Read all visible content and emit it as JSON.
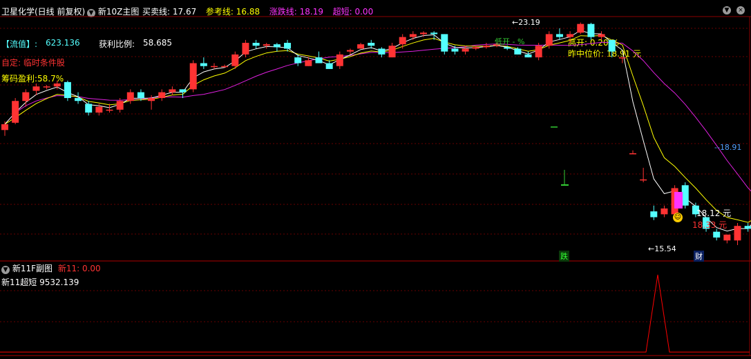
{
  "main_header": {
    "stock": "卫星化学(日线 前复权)",
    "indicator": "新10Z主图",
    "items": [
      {
        "label": "买卖线: 17.67",
        "color": "#ffffff"
      },
      {
        "label": "参考线: 16.88",
        "color": "#ffff00"
      },
      {
        "label": "涨跌线: 18.19",
        "color": "#ff33ff"
      },
      {
        "label": "超短: 0.00",
        "color": "#ff33ff"
      }
    ]
  },
  "info": {
    "float_label": "【流值】:",
    "float_value": "623.136",
    "profit_label": "获利比例:",
    "profit_value": "58.685",
    "custom": "自定: 临时条件股",
    "chip_profit": "筹码盈利:58.7%",
    "gap_open": "高开:  0.20 %",
    "prev_mid": "昨中位价:  18.91 元"
  },
  "annotations": {
    "high_label": "←23.19",
    "low_label": "←15.54",
    "last_label": "--18.91",
    "low_open_label": "低开 - %",
    "cost1": "18.12 元",
    "cost2": "18.33 元",
    "drop_tag": "跌",
    "money_tag": "财"
  },
  "sub_header": {
    "title": "新11F副图",
    "value": "新11: 0.00",
    "line2": "新11超短  9532.139"
  },
  "colors": {
    "up": "#ff3333",
    "down": "#54ffff",
    "white_line": "#ffffff",
    "yellow_line": "#ffff00",
    "magenta_line": "#e020e0",
    "spike": "#ff0000"
  },
  "chart_data": [
    {
      "type": "candlestick",
      "title": "卫星化学(日线 前复权)",
      "ohlc": [
        [
          19.5,
          19.8,
          19.3,
          19.7
        ],
        [
          19.75,
          20.6,
          19.7,
          20.5
        ],
        [
          20.5,
          20.9,
          20.3,
          20.8
        ],
        [
          20.85,
          21.1,
          20.7,
          21.0
        ],
        [
          21.0,
          21.05,
          20.9,
          21.0
        ],
        [
          21.0,
          21.2,
          20.9,
          21.1
        ],
        [
          21.15,
          21.2,
          20.5,
          20.6
        ],
        [
          20.6,
          20.8,
          20.4,
          20.5
        ],
        [
          20.4,
          20.5,
          20.0,
          20.1
        ],
        [
          20.1,
          20.4,
          20.0,
          20.3
        ],
        [
          20.2,
          20.4,
          20.1,
          20.2
        ],
        [
          20.2,
          20.6,
          20.1,
          20.5
        ],
        [
          20.5,
          20.9,
          20.4,
          20.8
        ],
        [
          20.8,
          20.9,
          20.5,
          20.6
        ],
        [
          20.5,
          20.7,
          20.2,
          20.6
        ],
        [
          20.6,
          20.9,
          20.5,
          20.8
        ],
        [
          20.8,
          21.0,
          20.7,
          20.9
        ],
        [
          20.9,
          20.9,
          20.6,
          20.8
        ],
        [
          20.9,
          21.9,
          20.8,
          21.8
        ],
        [
          21.8,
          22.0,
          21.6,
          21.7
        ],
        [
          21.7,
          21.8,
          21.6,
          21.7
        ],
        [
          21.7,
          21.75,
          21.65,
          21.7
        ],
        [
          21.7,
          22.2,
          21.6,
          22.1
        ],
        [
          22.1,
          22.6,
          22.0,
          22.5
        ],
        [
          22.5,
          22.6,
          22.3,
          22.4
        ],
        [
          22.4,
          22.5,
          22.3,
          22.45
        ],
        [
          22.45,
          22.5,
          22.2,
          22.35
        ],
        [
          22.5,
          22.6,
          22.2,
          22.3
        ],
        [
          22.0,
          22.1,
          21.7,
          21.8
        ],
        [
          21.7,
          22.0,
          21.7,
          21.9
        ],
        [
          22.0,
          22.2,
          21.8,
          21.8
        ],
        [
          21.8,
          21.9,
          21.6,
          21.6
        ],
        [
          21.7,
          22.2,
          21.6,
          22.1
        ],
        [
          22.2,
          22.3,
          22.1,
          22.25
        ],
        [
          22.3,
          22.5,
          22.3,
          22.45
        ],
        [
          22.5,
          22.6,
          22.3,
          22.4
        ],
        [
          22.3,
          22.35,
          22.0,
          22.1
        ],
        [
          22.0,
          22.5,
          22.0,
          22.4
        ],
        [
          22.45,
          22.8,
          22.3,
          22.7
        ],
        [
          22.7,
          22.9,
          22.6,
          22.8
        ],
        [
          22.8,
          22.9,
          22.7,
          22.85
        ],
        [
          22.85,
          22.9,
          22.6,
          22.8
        ],
        [
          22.8,
          22.8,
          22.1,
          22.2
        ],
        [
          22.3,
          22.4,
          22.1,
          22.2
        ],
        [
          22.2,
          22.4,
          22.1,
          22.3
        ],
        [
          22.3,
          22.4,
          22.25,
          22.35
        ],
        [
          22.35,
          22.5,
          22.3,
          22.4
        ],
        [
          22.4,
          22.5,
          22.35,
          22.45
        ],
        [
          22.35,
          22.4,
          22.25,
          22.3
        ],
        [
          22.3,
          22.35,
          22.1,
          22.1
        ],
        [
          22.1,
          22.2,
          22.0,
          22.0
        ],
        [
          22.0,
          22.5,
          21.9,
          22.4
        ],
        [
          22.4,
          22.9,
          22.3,
          22.8
        ],
        [
          22.8,
          23.0,
          22.6,
          22.7
        ],
        [
          22.7,
          22.9,
          22.5,
          22.8
        ],
        [
          22.85,
          23.2,
          22.8,
          23.15
        ],
        [
          23.15,
          23.19,
          22.6,
          22.7
        ],
        [
          22.7,
          22.9,
          22.6,
          22.8
        ],
        [
          22.6,
          22.6,
          22.0,
          22.2
        ],
        [
          22.0,
          22.0,
          21.8,
          22.0
        ],
        [
          18.7,
          18.8,
          18.7,
          18.7
        ],
        [
          17.8,
          18.2,
          17.7,
          17.8
        ],
        [
          16.7,
          16.9,
          16.4,
          16.5
        ],
        [
          16.6,
          16.9,
          16.5,
          16.8
        ],
        [
          16.6,
          17.6,
          16.5,
          17.5
        ],
        [
          17.6,
          17.7,
          16.8,
          16.9
        ],
        [
          16.9,
          17.0,
          16.5,
          16.6
        ],
        [
          16.5,
          16.5,
          16.0,
          16.1
        ],
        [
          16.0,
          16.1,
          15.7,
          15.8
        ],
        [
          15.7,
          15.9,
          15.6,
          15.9
        ],
        [
          15.7,
          16.3,
          15.54,
          16.2
        ],
        [
          16.2,
          16.3,
          16.0,
          16.1
        ],
        [
          16.5,
          17.0,
          16.6,
          17.0
        ],
        [
          17.1,
          17.2,
          16.9,
          17.2
        ],
        [
          18.9,
          19.1,
          18.6,
          19.0
        ],
        [
          18.95,
          19.0,
          18.7,
          18.8
        ]
      ],
      "overlays": [
        "买卖线",
        "参考线",
        "涨跌线"
      ],
      "high": 23.19,
      "low": 15.54,
      "last": 18.91
    },
    {
      "type": "line",
      "title": "新11F副图",
      "series": [
        {
          "name": "新11",
          "values": "zero except single spike near day 70"
        }
      ]
    }
  ]
}
